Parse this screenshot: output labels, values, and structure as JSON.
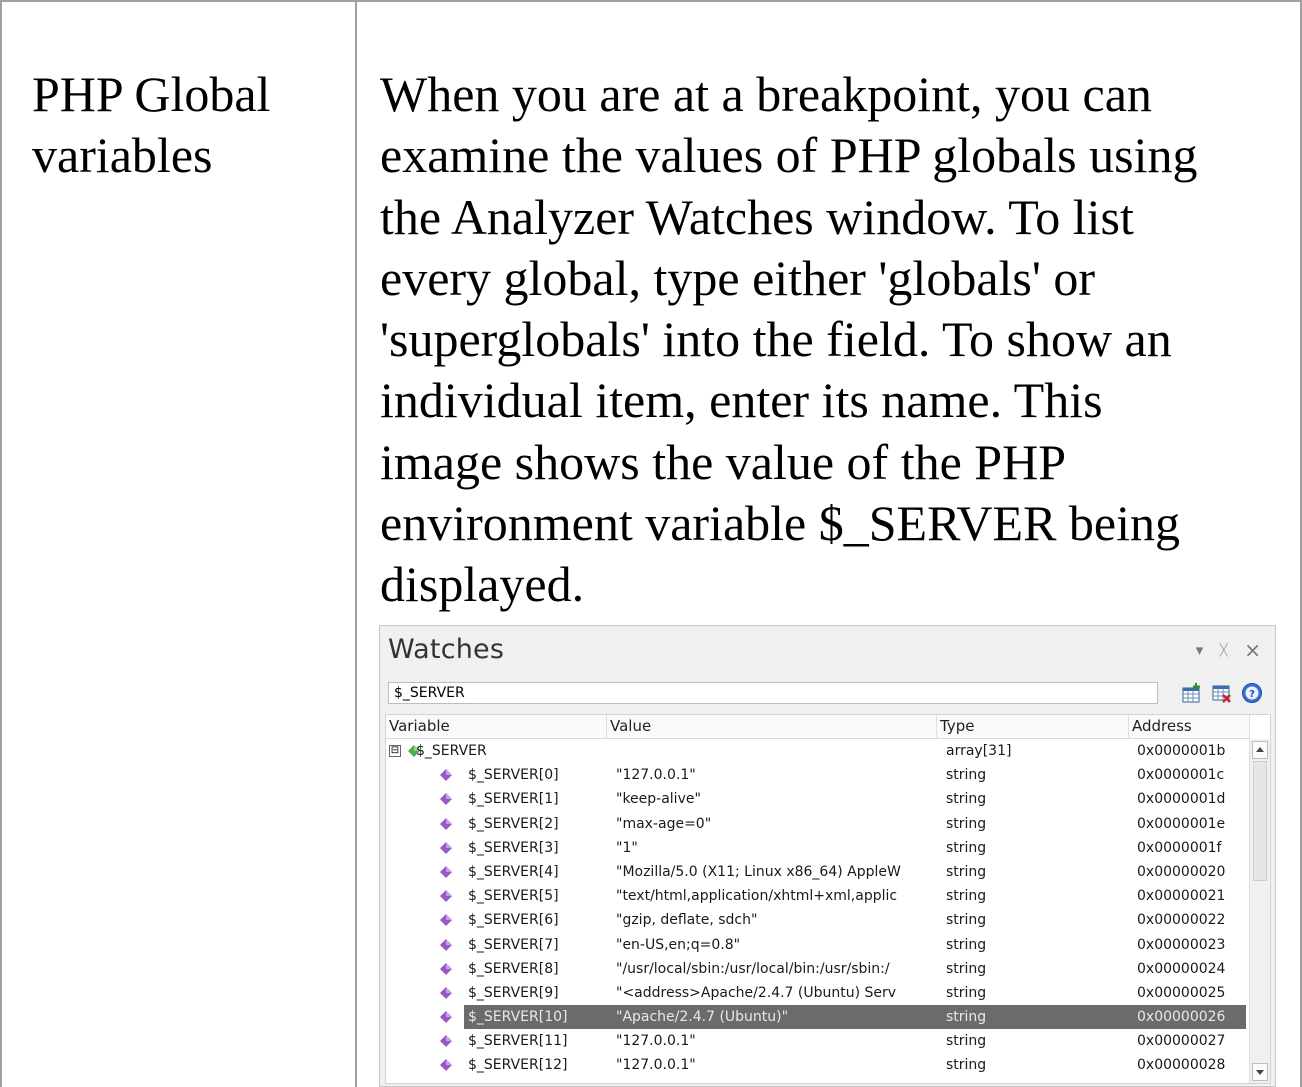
{
  "term": [
    "PHP Global",
    "variables"
  ],
  "description": [
    "When you are at a breakpoint, you can",
    "examine the values of PHP globals using",
    "the Analyzer Watches window. To list",
    "every global, type either 'globals' or",
    "'superglobals' into the field. To show an",
    "individual item, enter its name. This",
    "image shows the value of the PHP",
    "environment variable $_SERVER being",
    "displayed."
  ],
  "watches": {
    "title": "Watches",
    "input_value": "$_SERVER",
    "controls": {
      "dropdown": "▾",
      "pin": "ᚷ",
      "close": "×"
    },
    "columns": {
      "variable": "Variable",
      "value": "Value",
      "type": "Type",
      "address": "Address"
    },
    "root": {
      "expander": "⊟",
      "variable": "$_SERVER",
      "value": "",
      "type": "array[31]",
      "address": "0x0000001b"
    },
    "rows": [
      {
        "variable": "$_SERVER[0]",
        "value": "\"127.0.0.1\"",
        "type": "string",
        "address": "0x0000001c"
      },
      {
        "variable": "$_SERVER[1]",
        "value": "\"keep-alive\"",
        "type": "string",
        "address": "0x0000001d"
      },
      {
        "variable": "$_SERVER[2]",
        "value": "\"max-age=0\"",
        "type": "string",
        "address": "0x0000001e"
      },
      {
        "variable": "$_SERVER[3]",
        "value": "\"1\"",
        "type": "string",
        "address": "0x0000001f"
      },
      {
        "variable": "$_SERVER[4]",
        "value": "\"Mozilla/5.0 (X11; Linux x86_64) AppleW",
        "type": "string",
        "address": "0x00000020"
      },
      {
        "variable": "$_SERVER[5]",
        "value": "\"text/html,application/xhtml+xml,applic",
        "type": "string",
        "address": "0x00000021"
      },
      {
        "variable": "$_SERVER[6]",
        "value": "\"gzip, deflate, sdch\"",
        "type": "string",
        "address": "0x00000022"
      },
      {
        "variable": "$_SERVER[7]",
        "value": "\"en-US,en;q=0.8\"",
        "type": "string",
        "address": "0x00000023"
      },
      {
        "variable": "$_SERVER[8]",
        "value": "\"/usr/local/sbin:/usr/local/bin:/usr/sbin:/",
        "type": "string",
        "address": "0x00000024"
      },
      {
        "variable": "$_SERVER[9]",
        "value": "\"<address>Apache/2.4.7 (Ubuntu) Serv",
        "type": "string",
        "address": "0x00000025"
      },
      {
        "variable": "$_SERVER[10]",
        "value": "\"Apache/2.4.7 (Ubuntu)\"",
        "type": "string",
        "address": "0x00000026",
        "selected": true
      },
      {
        "variable": "$_SERVER[11]",
        "value": "\"127.0.0.1\"",
        "type": "string",
        "address": "0x00000027"
      },
      {
        "variable": "$_SERVER[12]",
        "value": "\"127.0.0.1\"",
        "type": "string",
        "address": "0x00000028"
      }
    ],
    "colors": {
      "gem_root": "#4caf50",
      "gem_item": "#9b59c6",
      "selection": "#6b6b6b"
    }
  }
}
